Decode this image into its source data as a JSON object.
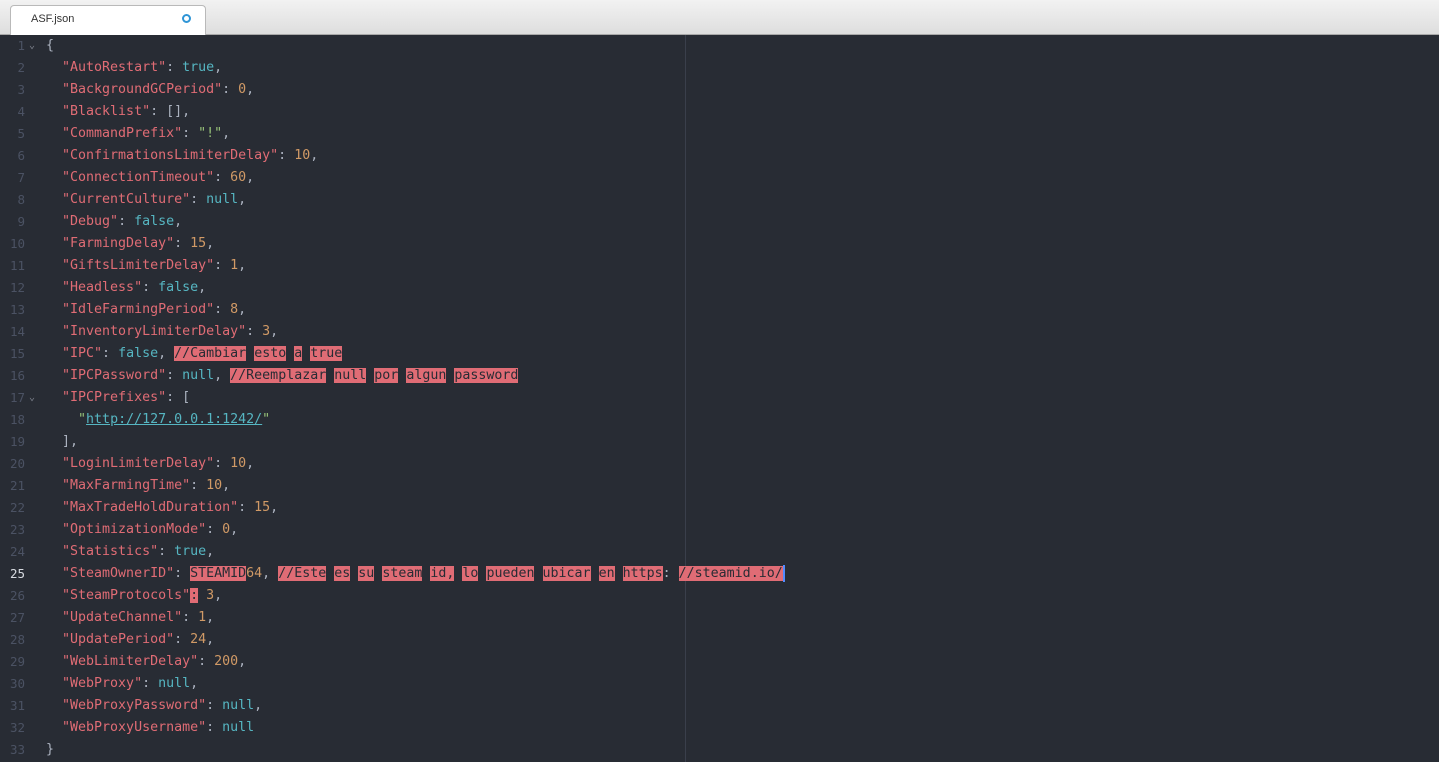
{
  "tab": {
    "title": "ASF.json"
  },
  "editor": {
    "active_line": 25,
    "lines": [
      {
        "n": "1",
        "fold": true,
        "tokens": [
          {
            "t": "p",
            "v": "{"
          }
        ]
      },
      {
        "n": "2",
        "tokens": [
          {
            "t": "p",
            "v": "  "
          },
          {
            "t": "key",
            "v": "\"AutoRestart\""
          },
          {
            "t": "p",
            "v": ": "
          },
          {
            "t": "kw",
            "v": "true"
          },
          {
            "t": "p",
            "v": ","
          }
        ]
      },
      {
        "n": "3",
        "tokens": [
          {
            "t": "p",
            "v": "  "
          },
          {
            "t": "key",
            "v": "\"BackgroundGCPeriod\""
          },
          {
            "t": "p",
            "v": ": "
          },
          {
            "t": "num",
            "v": "0"
          },
          {
            "t": "p",
            "v": ","
          }
        ]
      },
      {
        "n": "4",
        "tokens": [
          {
            "t": "p",
            "v": "  "
          },
          {
            "t": "key",
            "v": "\"Blacklist\""
          },
          {
            "t": "p",
            "v": ": [],"
          }
        ]
      },
      {
        "n": "5",
        "tokens": [
          {
            "t": "p",
            "v": "  "
          },
          {
            "t": "key",
            "v": "\"CommandPrefix\""
          },
          {
            "t": "p",
            "v": ": "
          },
          {
            "t": "str",
            "v": "\"!\""
          },
          {
            "t": "p",
            "v": ","
          }
        ]
      },
      {
        "n": "6",
        "tokens": [
          {
            "t": "p",
            "v": "  "
          },
          {
            "t": "key",
            "v": "\"ConfirmationsLimiterDelay\""
          },
          {
            "t": "p",
            "v": ": "
          },
          {
            "t": "num",
            "v": "10"
          },
          {
            "t": "p",
            "v": ","
          }
        ]
      },
      {
        "n": "7",
        "tokens": [
          {
            "t": "p",
            "v": "  "
          },
          {
            "t": "key",
            "v": "\"ConnectionTimeout\""
          },
          {
            "t": "p",
            "v": ": "
          },
          {
            "t": "num",
            "v": "60"
          },
          {
            "t": "p",
            "v": ","
          }
        ]
      },
      {
        "n": "8",
        "tokens": [
          {
            "t": "p",
            "v": "  "
          },
          {
            "t": "key",
            "v": "\"CurrentCulture\""
          },
          {
            "t": "p",
            "v": ": "
          },
          {
            "t": "kw",
            "v": "null"
          },
          {
            "t": "p",
            "v": ","
          }
        ]
      },
      {
        "n": "9",
        "tokens": [
          {
            "t": "p",
            "v": "  "
          },
          {
            "t": "key",
            "v": "\"Debug\""
          },
          {
            "t": "p",
            "v": ": "
          },
          {
            "t": "kw",
            "v": "false"
          },
          {
            "t": "p",
            "v": ","
          }
        ]
      },
      {
        "n": "10",
        "tokens": [
          {
            "t": "p",
            "v": "  "
          },
          {
            "t": "key",
            "v": "\"FarmingDelay\""
          },
          {
            "t": "p",
            "v": ": "
          },
          {
            "t": "num",
            "v": "15"
          },
          {
            "t": "p",
            "v": ","
          }
        ]
      },
      {
        "n": "11",
        "tokens": [
          {
            "t": "p",
            "v": "  "
          },
          {
            "t": "key",
            "v": "\"GiftsLimiterDelay\""
          },
          {
            "t": "p",
            "v": ": "
          },
          {
            "t": "num",
            "v": "1"
          },
          {
            "t": "p",
            "v": ","
          }
        ]
      },
      {
        "n": "12",
        "tokens": [
          {
            "t": "p",
            "v": "  "
          },
          {
            "t": "key",
            "v": "\"Headless\""
          },
          {
            "t": "p",
            "v": ": "
          },
          {
            "t": "kw",
            "v": "false"
          },
          {
            "t": "p",
            "v": ","
          }
        ]
      },
      {
        "n": "13",
        "tokens": [
          {
            "t": "p",
            "v": "  "
          },
          {
            "t": "key",
            "v": "\"IdleFarmingPeriod\""
          },
          {
            "t": "p",
            "v": ": "
          },
          {
            "t": "num",
            "v": "8"
          },
          {
            "t": "p",
            "v": ","
          }
        ]
      },
      {
        "n": "14",
        "tokens": [
          {
            "t": "p",
            "v": "  "
          },
          {
            "t": "key",
            "v": "\"InventoryLimiterDelay\""
          },
          {
            "t": "p",
            "v": ": "
          },
          {
            "t": "num",
            "v": "3"
          },
          {
            "t": "p",
            "v": ","
          }
        ]
      },
      {
        "n": "15",
        "tokens": [
          {
            "t": "p",
            "v": "  "
          },
          {
            "t": "key",
            "v": "\"IPC\""
          },
          {
            "t": "p",
            "v": ": "
          },
          {
            "t": "kw",
            "v": "false"
          },
          {
            "t": "p",
            "v": ", "
          },
          {
            "t": "err",
            "v": "//Cambiar"
          },
          {
            "t": "p",
            "v": " "
          },
          {
            "t": "err",
            "v": "esto"
          },
          {
            "t": "p",
            "v": " "
          },
          {
            "t": "err",
            "v": "a"
          },
          {
            "t": "p",
            "v": " "
          },
          {
            "t": "err",
            "v": "true"
          }
        ]
      },
      {
        "n": "16",
        "tokens": [
          {
            "t": "p",
            "v": "  "
          },
          {
            "t": "key",
            "v": "\"IPCPassword\""
          },
          {
            "t": "p",
            "v": ": "
          },
          {
            "t": "kw",
            "v": "null"
          },
          {
            "t": "p",
            "v": ", "
          },
          {
            "t": "err",
            "v": "//Reemplazar"
          },
          {
            "t": "p",
            "v": " "
          },
          {
            "t": "err",
            "v": "null"
          },
          {
            "t": "p",
            "v": " "
          },
          {
            "t": "err",
            "v": "por"
          },
          {
            "t": "p",
            "v": " "
          },
          {
            "t": "err",
            "v": "algun"
          },
          {
            "t": "p",
            "v": " "
          },
          {
            "t": "err",
            "v": "password"
          }
        ]
      },
      {
        "n": "17",
        "fold": true,
        "tokens": [
          {
            "t": "p",
            "v": "  "
          },
          {
            "t": "key",
            "v": "\"IPCPrefixes\""
          },
          {
            "t": "p",
            "v": ": ["
          }
        ]
      },
      {
        "n": "18",
        "tokens": [
          {
            "t": "p",
            "v": "    "
          },
          {
            "t": "str",
            "v": "\""
          },
          {
            "t": "url",
            "v": "http://127.0.0.1:1242/"
          },
          {
            "t": "str",
            "v": "\""
          }
        ]
      },
      {
        "n": "19",
        "tokens": [
          {
            "t": "p",
            "v": "  ],"
          }
        ]
      },
      {
        "n": "20",
        "tokens": [
          {
            "t": "p",
            "v": "  "
          },
          {
            "t": "key",
            "v": "\"LoginLimiterDelay\""
          },
          {
            "t": "p",
            "v": ": "
          },
          {
            "t": "num",
            "v": "10"
          },
          {
            "t": "p",
            "v": ","
          }
        ]
      },
      {
        "n": "21",
        "tokens": [
          {
            "t": "p",
            "v": "  "
          },
          {
            "t": "key",
            "v": "\"MaxFarmingTime\""
          },
          {
            "t": "p",
            "v": ": "
          },
          {
            "t": "num",
            "v": "10"
          },
          {
            "t": "p",
            "v": ","
          }
        ]
      },
      {
        "n": "22",
        "tokens": [
          {
            "t": "p",
            "v": "  "
          },
          {
            "t": "key",
            "v": "\"MaxTradeHoldDuration\""
          },
          {
            "t": "p",
            "v": ": "
          },
          {
            "t": "num",
            "v": "15"
          },
          {
            "t": "p",
            "v": ","
          }
        ]
      },
      {
        "n": "23",
        "tokens": [
          {
            "t": "p",
            "v": "  "
          },
          {
            "t": "key",
            "v": "\"OptimizationMode\""
          },
          {
            "t": "p",
            "v": ": "
          },
          {
            "t": "num",
            "v": "0"
          },
          {
            "t": "p",
            "v": ","
          }
        ]
      },
      {
        "n": "24",
        "tokens": [
          {
            "t": "p",
            "v": "  "
          },
          {
            "t": "key",
            "v": "\"Statistics\""
          },
          {
            "t": "p",
            "v": ": "
          },
          {
            "t": "kw",
            "v": "true"
          },
          {
            "t": "p",
            "v": ","
          }
        ]
      },
      {
        "n": "25",
        "tokens": [
          {
            "t": "p",
            "v": "  "
          },
          {
            "t": "key",
            "v": "\"SteamOwnerID\""
          },
          {
            "t": "p",
            "v": ": "
          },
          {
            "t": "err",
            "v": "STEAMID"
          },
          {
            "t": "num",
            "v": "64"
          },
          {
            "t": "p",
            "v": ", "
          },
          {
            "t": "err",
            "v": "//Este"
          },
          {
            "t": "p",
            "v": " "
          },
          {
            "t": "err",
            "v": "es"
          },
          {
            "t": "p",
            "v": " "
          },
          {
            "t": "err",
            "v": "su"
          },
          {
            "t": "p",
            "v": " "
          },
          {
            "t": "err",
            "v": "steam"
          },
          {
            "t": "p",
            "v": " "
          },
          {
            "t": "err",
            "v": "id,"
          },
          {
            "t": "p",
            "v": " "
          },
          {
            "t": "err",
            "v": "lo"
          },
          {
            "t": "p",
            "v": " "
          },
          {
            "t": "err",
            "v": "pueden"
          },
          {
            "t": "p",
            "v": " "
          },
          {
            "t": "err",
            "v": "ubicar"
          },
          {
            "t": "p",
            "v": " "
          },
          {
            "t": "err",
            "v": "en"
          },
          {
            "t": "p",
            "v": " "
          },
          {
            "t": "err",
            "v": "https"
          },
          {
            "t": "p",
            "v": ": "
          },
          {
            "t": "err",
            "v": "//steamid.io/"
          },
          {
            "t": "cursor",
            "v": ""
          }
        ]
      },
      {
        "n": "26",
        "tokens": [
          {
            "t": "p",
            "v": "  "
          },
          {
            "t": "key",
            "v": "\"SteamProtocols\""
          },
          {
            "t": "err",
            "v": ":"
          },
          {
            "t": "p",
            "v": " "
          },
          {
            "t": "num",
            "v": "3"
          },
          {
            "t": "p",
            "v": ","
          }
        ]
      },
      {
        "n": "27",
        "tokens": [
          {
            "t": "p",
            "v": "  "
          },
          {
            "t": "key",
            "v": "\"UpdateChannel\""
          },
          {
            "t": "p",
            "v": ": "
          },
          {
            "t": "num",
            "v": "1"
          },
          {
            "t": "p",
            "v": ","
          }
        ]
      },
      {
        "n": "28",
        "tokens": [
          {
            "t": "p",
            "v": "  "
          },
          {
            "t": "key",
            "v": "\"UpdatePeriod\""
          },
          {
            "t": "p",
            "v": ": "
          },
          {
            "t": "num",
            "v": "24"
          },
          {
            "t": "p",
            "v": ","
          }
        ]
      },
      {
        "n": "29",
        "tokens": [
          {
            "t": "p",
            "v": "  "
          },
          {
            "t": "key",
            "v": "\"WebLimiterDelay\""
          },
          {
            "t": "p",
            "v": ": "
          },
          {
            "t": "num",
            "v": "200"
          },
          {
            "t": "p",
            "v": ","
          }
        ]
      },
      {
        "n": "30",
        "tokens": [
          {
            "t": "p",
            "v": "  "
          },
          {
            "t": "key",
            "v": "\"WebProxy\""
          },
          {
            "t": "p",
            "v": ": "
          },
          {
            "t": "kw",
            "v": "null"
          },
          {
            "t": "p",
            "v": ","
          }
        ]
      },
      {
        "n": "31",
        "tokens": [
          {
            "t": "p",
            "v": "  "
          },
          {
            "t": "key",
            "v": "\"WebProxyPassword\""
          },
          {
            "t": "p",
            "v": ": "
          },
          {
            "t": "kw",
            "v": "null"
          },
          {
            "t": "p",
            "v": ","
          }
        ]
      },
      {
        "n": "32",
        "tokens": [
          {
            "t": "p",
            "v": "  "
          },
          {
            "t": "key",
            "v": "\"WebProxyUsername\""
          },
          {
            "t": "p",
            "v": ": "
          },
          {
            "t": "kw",
            "v": "null"
          }
        ]
      },
      {
        "n": "33",
        "tokens": [
          {
            "t": "p",
            "v": "}"
          }
        ]
      }
    ]
  }
}
